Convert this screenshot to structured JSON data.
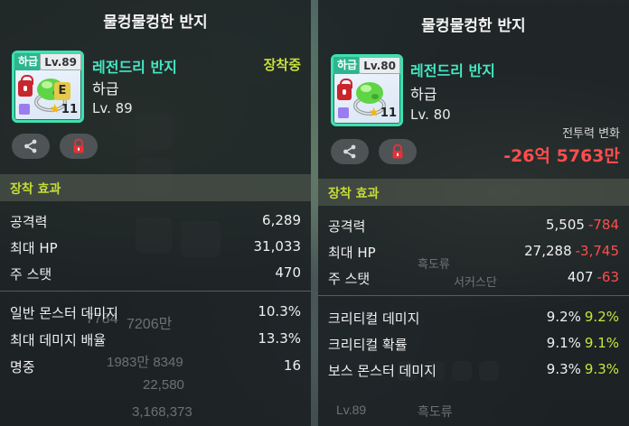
{
  "left": {
    "title": "물컹물컹한 반지",
    "icon": {
      "grade_tag": "하급",
      "level_tag": "Lv.89",
      "equip_badge": "E",
      "star_count": "11",
      "lock_icon": "lock-icon",
      "art": "green-slime-ring"
    },
    "item_name": "레전드리 반지",
    "item_grade": "하급",
    "item_level": "Lv. 89",
    "equipped_label": "장착중",
    "buttons": {
      "share": "share-icon",
      "lock": "lock-icon"
    },
    "section_title": "장착 효과",
    "stats": [
      {
        "label": "공격력",
        "value": "6,289"
      },
      {
        "label": "최대 HP",
        "value": "31,033"
      },
      {
        "label": "주 스탯",
        "value": "470"
      }
    ],
    "stats2": [
      {
        "label": "일반 몬스터 데미지",
        "value": "10.3%"
      },
      {
        "label": "최대 데미지 배율",
        "value": "13.3%"
      },
      {
        "label": "명중",
        "value": "16"
      }
    ]
  },
  "right": {
    "title": "물컹물컹한 반지",
    "icon": {
      "grade_tag": "하급",
      "level_tag": "Lv.80",
      "star_count": "11",
      "lock_icon": "lock-icon",
      "art": "green-slime-ring"
    },
    "item_name": "레전드리 반지",
    "item_grade": "하급",
    "item_level": "Lv. 80",
    "combat_label": "전투력 변화",
    "combat_value": "-26억 5763만",
    "buttons": {
      "share": "share-icon",
      "lock": "lock-icon"
    },
    "section_title": "장착 효과",
    "stats": [
      {
        "label": "공격력",
        "value": "5,505",
        "diff": "-784"
      },
      {
        "label": "최대 HP",
        "value": "27,288",
        "diff": "-3,745"
      },
      {
        "label": "주 스탯",
        "value": "407",
        "diff": "-63"
      }
    ],
    "stats2": [
      {
        "label": "크리티컬 데미지",
        "value": "9.2%",
        "diff": "9.2%"
      },
      {
        "label": "크리티컬 확률",
        "value": "9.1%",
        "diff": "9.1%"
      },
      {
        "label": "보스 몬스터 데미지",
        "value": "9.3%",
        "diff": "9.3%"
      }
    ]
  },
  "background": {
    "texts": [
      "7784",
      "7206만",
      "1983만 8349",
      "22,580",
      "3,168,373",
      "흑도류",
      "서커스단",
      "Lv.89",
      "흑도류"
    ]
  },
  "colors": {
    "accent_green": "#45e8c3",
    "equipped_yellow": "#c6df3c",
    "down_red": "#ff4d4d",
    "up_green": "#c8e63c"
  }
}
